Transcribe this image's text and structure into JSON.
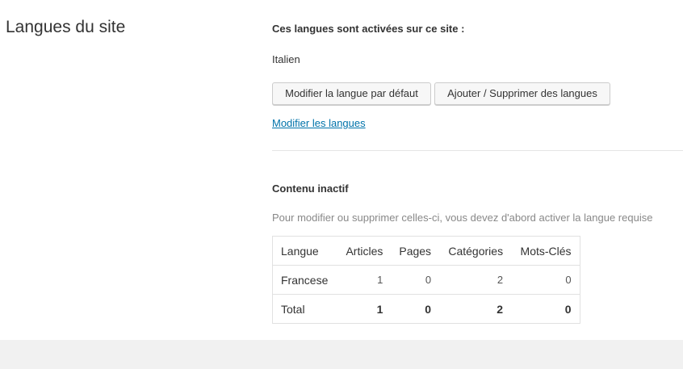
{
  "section": {
    "title": "Langues du site"
  },
  "active": {
    "heading": "Ces langues sont activées sur ce site :",
    "languages": [
      "Italien"
    ],
    "buttons": {
      "set_default": "Modifier la langue par défaut",
      "add_remove": "Ajouter / Supprimer des langues"
    },
    "edit_link": "Modifier les langues"
  },
  "inactive": {
    "heading": "Contenu inactif",
    "description": "Pour modifier ou supprimer celles-ci, vous devez d'abord activer la langue requise",
    "table": {
      "headers": [
        "Langue",
        "Articles",
        "Pages",
        "Catégories",
        "Mots-Clés"
      ],
      "rows": [
        [
          "Francese",
          "1",
          "0",
          "2",
          "0"
        ]
      ],
      "total": [
        "Total",
        "1",
        "0",
        "2",
        "0"
      ]
    }
  }
}
